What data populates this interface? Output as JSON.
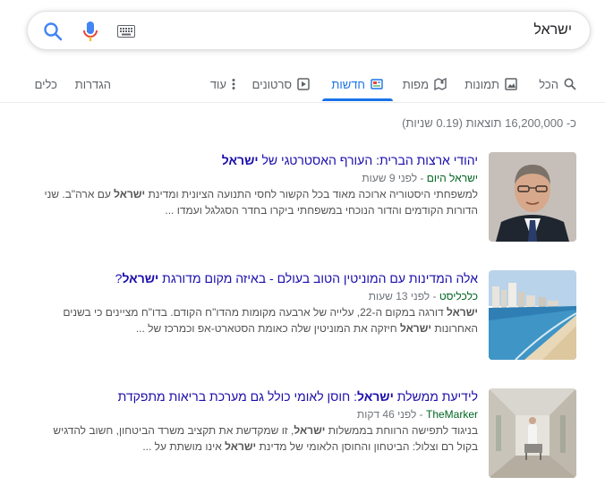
{
  "search": {
    "query": "ישראל"
  },
  "tabs": [
    {
      "label": "הכל",
      "icon": "search-icon"
    },
    {
      "label": "תמונות",
      "icon": "image-icon"
    },
    {
      "label": "מפות",
      "icon": "map-icon"
    },
    {
      "label": "חדשות",
      "icon": "news-icon",
      "active": true
    },
    {
      "label": "סרטונים",
      "icon": "play-icon"
    },
    {
      "label": "עוד",
      "icon": "more-icon"
    },
    {
      "label": "הגדרות"
    },
    {
      "label": "כלים"
    }
  ],
  "stats": "כ- 16,200,000 תוצאות (0.19 שניות)",
  "results": [
    {
      "title_pre": "יהודי ארצות הברית: העורף האסטרטגי של ",
      "title_bold": "ישראל",
      "title_post": "",
      "source": "ישראל היום",
      "age": "- לפני 9 שעות",
      "snippet_a": "למשפחתי היסטוריה ארוכה מאוד בכל הקשור לחסי התנועה הציונית ומדינת ",
      "snippet_bold": "ישראל",
      "snippet_b": " עם ארה\"ב. שני הדורות הקודמים והדור הנוכחי במשפחתי ביקרו בחדר הסגלגל ועמדו ...",
      "snippet_bold2": "",
      "snippet_c": ""
    },
    {
      "title_pre": "אלה המדינות עם המוניטין הטוב בעולם - באיזה מקום מדורגת ",
      "title_bold": "ישראל",
      "title_post": "?",
      "source": "כלכליסט",
      "age": "- לפני 13 שעות",
      "snippet_a": "",
      "snippet_bold": "ישראל",
      "snippet_b": " דורגה במקום ה-22, עלייה של ארבעה מקומות מהדו\"ח הקודם. בדו\"ח מציינים כי בשנים האחרונות ",
      "snippet_bold2": "ישראל",
      "snippet_c": " חיזקה את המוניטין שלה כאומת הסטארט-אפ וכמרכז של ..."
    },
    {
      "title_pre": "לידיעת ממשלת ",
      "title_bold": "ישראל",
      "title_post": ": חוסן לאומי כולל גם מערכת בריאות מתפקדת",
      "source": "TheMarker",
      "age": "- לפני 46 דקות",
      "snippet_a": "בניגוד לתפישה הרווחת בממשלות ",
      "snippet_bold": "ישראל",
      "snippet_b": ", זו שמקדשת את תקציב משרד הביטחון, חשוב להדגיש בקול רם וצלול: הביטחון והחוסן הלאומי של מדינת ",
      "snippet_bold2": "ישראל",
      "snippet_c": " אינו מושתת על ..."
    }
  ],
  "colors": {
    "link": "#1a0dab",
    "accent": "#1a73e8",
    "url": "#006621"
  }
}
